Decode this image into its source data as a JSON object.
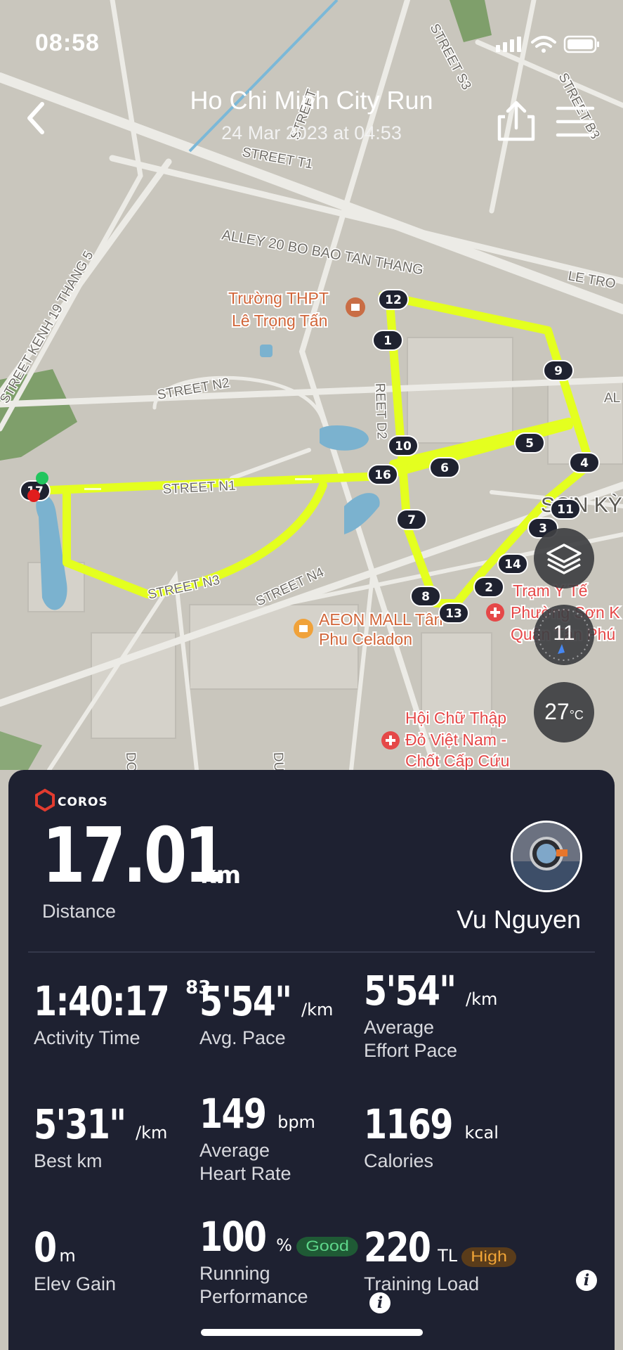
{
  "status_bar": {
    "time": "08:58",
    "icons": [
      "signal-icon",
      "wifi-icon",
      "battery-icon"
    ]
  },
  "header": {
    "title": "Ho Chi Minh City Run",
    "subtitle": "24 Mar 2023 at 04:53"
  },
  "map": {
    "streets": [
      "STREET S3",
      "STREET B3",
      "STREET T1",
      "STREET",
      "ALLEY 20 BO BAO TAN THANG",
      "LE TRO",
      "STREET KENH 19 THANG 5",
      "STREET N2",
      "STREET N1",
      "STREET N3",
      "STREET N4",
      "REET D2",
      "AL",
      "SƠN KỲ",
      "DƯ",
      "DO"
    ],
    "pois": [
      {
        "name": "Trường THPT\nLê Trọng Tấn",
        "line1": "Trường THPT",
        "line2": "Lê Trọng Tấn",
        "icon": "school-icon"
      },
      {
        "line1": "AEON MALL Tân",
        "line2": "Phu Celadon",
        "icon": "shopping-icon"
      },
      {
        "line1": "Trạm Y Tế",
        "line2": "Phường Sơn K",
        "line3": "Quận Tân Phú",
        "icon": "medical-icon"
      },
      {
        "line1": "Hội Chữ Thập",
        "line2": "Đỏ Việt Nam -",
        "line3": "Chốt Cấp Cứu",
        "icon": "medical-icon"
      }
    ],
    "km_markers": [
      "1",
      "2",
      "3",
      "4",
      "5",
      "6",
      "7",
      "8",
      "9",
      "10",
      "11",
      "12",
      "13",
      "14",
      "16",
      "17"
    ],
    "compass_value": "11",
    "temperature": "27",
    "temperature_unit": "°C",
    "route_color": "#e4ff1f"
  },
  "card": {
    "brand": "COROS",
    "distance": {
      "value": "17.01",
      "unit": "km",
      "label": "Distance"
    },
    "user_name": "Vu Nguyen",
    "stats": [
      {
        "value": "1:40:17",
        "sup": "83",
        "unit": "",
        "label": "Activity Time"
      },
      {
        "value": "5'54\"",
        "unit": "/km",
        "label": "Avg. Pace"
      },
      {
        "value": "5'54\"",
        "unit": "/km",
        "label": "Average\nEffort Pace",
        "l1": "Average",
        "l2": "Effort Pace"
      },
      {
        "value": "5'31\"",
        "unit": "/km",
        "label": "Best km"
      },
      {
        "value": "149",
        "unit": "bpm",
        "l1": "Average",
        "l2": "Heart Rate"
      },
      {
        "value": "1169",
        "unit": "kcal",
        "label": "Calories"
      },
      {
        "value": "0",
        "unit": "m",
        "label": "Elev Gain"
      },
      {
        "value": "100",
        "unit": "%",
        "badge": "Good",
        "l1": "Running",
        "l2": "Performance"
      },
      {
        "value": "220",
        "unit": "TL",
        "badge": "High",
        "label": "Training Load"
      }
    ]
  }
}
